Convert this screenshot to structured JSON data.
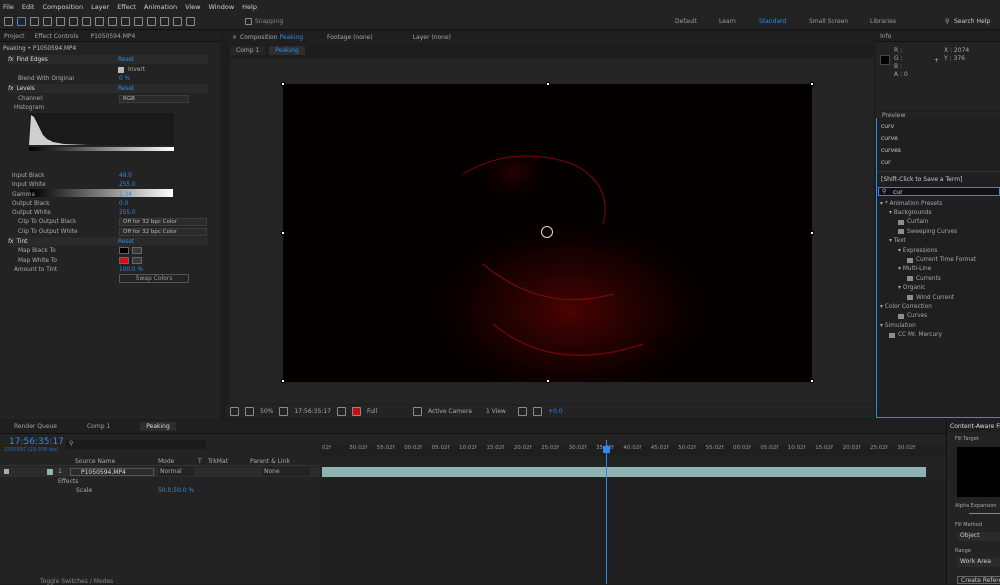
{
  "menu": [
    "File",
    "Edit",
    "Composition",
    "Layer",
    "Effect",
    "Animation",
    "View",
    "Window",
    "Help"
  ],
  "toolbar": {
    "snapping": "Snapping",
    "workspaces": [
      "Default",
      "Learn",
      "Standard",
      "Small Screen",
      "Libraries"
    ],
    "search": "Search Help"
  },
  "project": {
    "tab": "Project",
    "fx_tab": "Effect Controls",
    "fx_file": "P1050594.MP4",
    "subtitle": "Peaking • P1050594.MP4"
  },
  "effects": {
    "find_edges": "Find Edges",
    "reset": "Reset",
    "invert": "Invert",
    "blend": "Blend With Original",
    "blend_val": "0 %",
    "levels": "Levels",
    "channel": "Channel:",
    "channel_val": "RGB",
    "histogram": "Histogram",
    "input_black": "Input Black",
    "input_black_val": "49.0",
    "input_white": "Input White",
    "input_white_val": "255.0",
    "gamma": "Gamma",
    "gamma_val": "1.34",
    "output_black": "Output Black",
    "output_black_val": "0.0",
    "output_white": "Output White",
    "output_white_val": "255.0",
    "clip_black": "Clip To Output Black",
    "clip_white": "Clip To Output White",
    "clip_val": "Off for 32 bpc Color",
    "tint": "Tint",
    "map_black": "Map Black To",
    "map_white": "Map White To",
    "amount": "Amount to Tint",
    "amount_val": "100.0 %",
    "swap": "Swap Colors"
  },
  "comp_tabs": {
    "composition": "Composition",
    "comp_name": "Peaking",
    "footage": "Footage (none)",
    "layer": "Layer (none)",
    "flow1": "Comp 1",
    "flow2": "Peaking"
  },
  "viewer_bar": {
    "zoom": "50%",
    "timecode": "17:56:35:17",
    "res": "Full",
    "camera": "Active Camera",
    "views": "1 View",
    "exposure": "+0.0"
  },
  "info": {
    "tab": "Info",
    "r": "R :",
    "g": "G :",
    "b": "B :",
    "a": "A : 0",
    "x": "X : 2074",
    "y": "Y : 376"
  },
  "preview_tab": "Preview",
  "autocomplete": [
    "curv",
    "curve",
    "curves",
    "cur"
  ],
  "search_hint": "[Shift-Click to Save a Term]",
  "search_value": "cur",
  "tree": [
    {
      "t": "* Animation Presets",
      "d": 0,
      "f": false
    },
    {
      "t": "Backgrounds",
      "d": 1,
      "f": false
    },
    {
      "t": "Curtain",
      "d": 2,
      "f": true
    },
    {
      "t": "Sweeping Curves",
      "d": 2,
      "f": true
    },
    {
      "t": "Text",
      "d": 1,
      "f": false
    },
    {
      "t": "Expressions",
      "d": 2,
      "f": false
    },
    {
      "t": "Current Time Format",
      "d": 3,
      "f": true
    },
    {
      "t": "Multi-Line",
      "d": 2,
      "f": false
    },
    {
      "t": "Currents",
      "d": 3,
      "f": true
    },
    {
      "t": "Organic",
      "d": 2,
      "f": false
    },
    {
      "t": "Wind Current",
      "d": 3,
      "f": true
    },
    {
      "t": "Color Correction",
      "d": 0,
      "f": false
    },
    {
      "t": "Curves",
      "d": 2,
      "f": true
    },
    {
      "t": "Simulation",
      "d": 0,
      "f": false
    },
    {
      "t": "CC Mr. Mercury",
      "d": 1,
      "f": true
    }
  ],
  "timeline": {
    "render_queue": "Render Queue",
    "comp1": "Comp 1",
    "peaking": "Peaking",
    "timecode": "17:56:35:17",
    "frames": "1550297 (23.976 fps)",
    "cols": {
      "name": "Source Name",
      "mode": "Mode",
      "t": "T",
      "trkmat": "TrkMat",
      "parent": "Parent & Link"
    },
    "layer_num": "1",
    "layer_name": "P1050594.MP4",
    "layer_mode": "Normal",
    "layer_parent": "None",
    "effects": "Effects",
    "scale": "Scale",
    "scale_val": "50.0,50.0 %",
    "toggle": "Toggle Switches / Modes",
    "ticks": [
      "02f",
      "50:02f",
      "55:02f",
      "00:02f",
      "05:02f",
      "10:02f",
      "15:02f",
      "20:02f",
      "25:02f",
      "30:02f",
      "35:02f",
      "40:02f",
      "45:02f",
      "50:02f",
      "55:02f",
      "00:02f",
      "05:02f",
      "10:02f",
      "15:02f",
      "20:02f",
      "25:02f",
      "30:02f"
    ]
  },
  "caf": {
    "title": "Content-Aware Fill",
    "fill_target": "Fill Target",
    "alpha": "Alpha Expansion",
    "fill_method": "Fill Method",
    "fill_method_val": "Object",
    "range": "Range",
    "range_val": "Work Area",
    "create": "Create Reference Frame"
  }
}
